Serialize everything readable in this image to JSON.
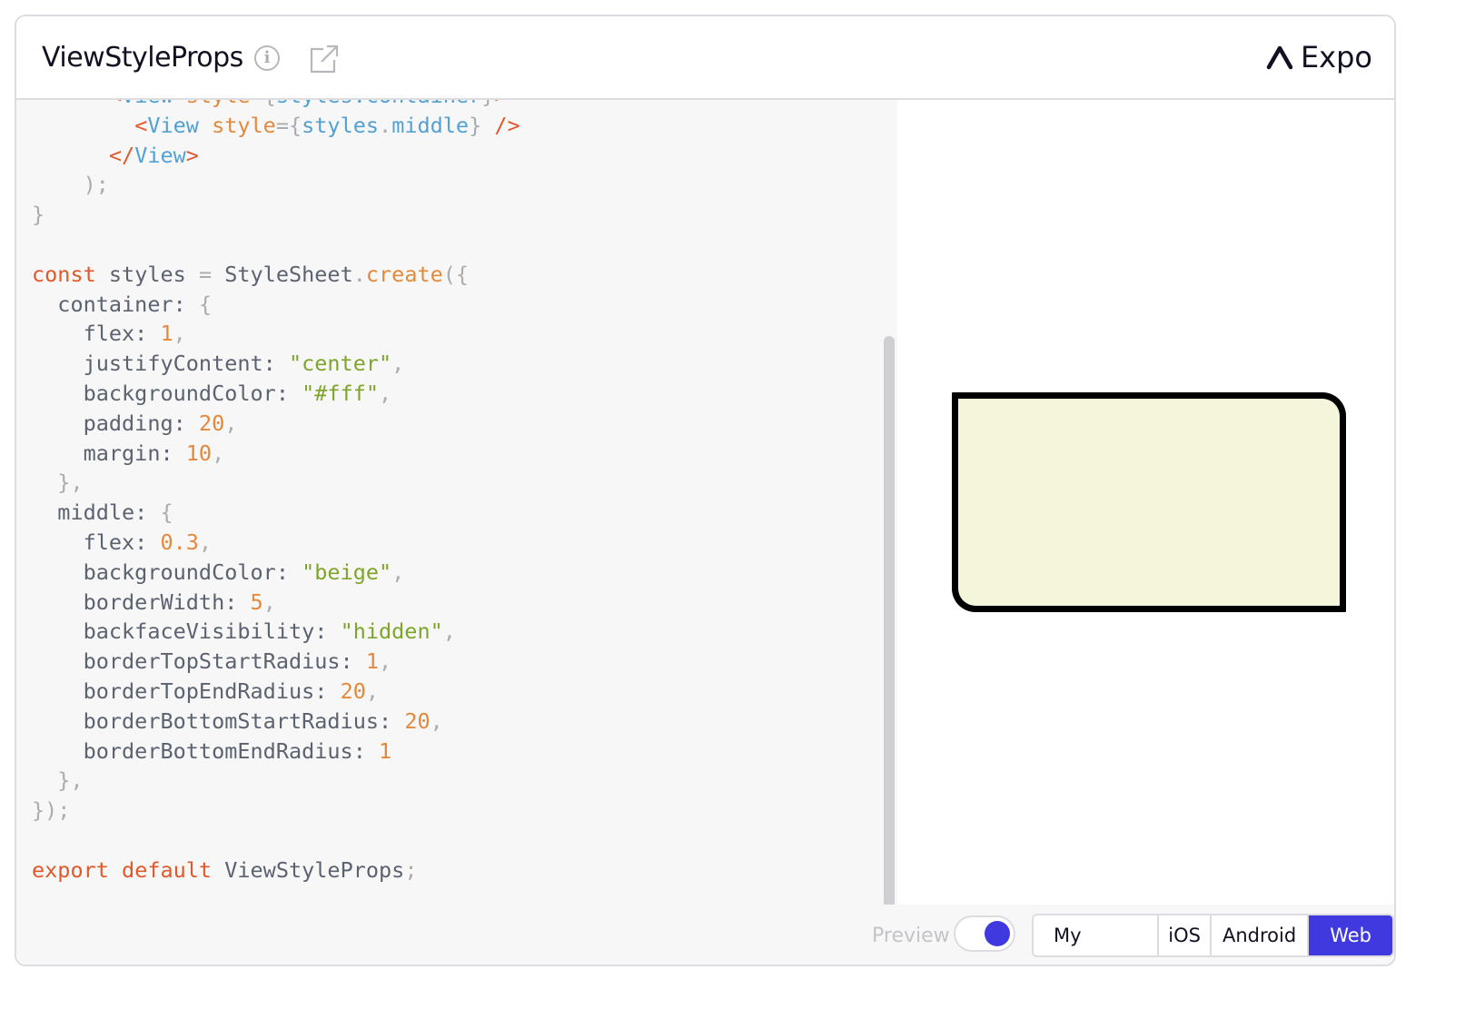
{
  "header": {
    "title": "ViewStyleProps",
    "info_icon": "info-icon",
    "open_external_icon": "external-link-icon",
    "brand": "Expo",
    "brand_icon": "expo-logo-icon"
  },
  "code": {
    "lines": [
      [
        {
          "c": "t",
          "v": "      "
        },
        {
          "c": "k",
          "v": "<"
        },
        {
          "c": "t",
          "v": "View "
        },
        {
          "c": "a",
          "v": "style"
        },
        {
          "c": "p",
          "v": "={"
        },
        {
          "c": "t",
          "v": "styles.container"
        },
        {
          "c": "p",
          "v": "}"
        },
        {
          "c": "k",
          "v": ">"
        }
      ],
      [
        {
          "c": "t",
          "v": "        "
        },
        {
          "c": "k",
          "v": "<"
        },
        {
          "c": "t",
          "v": "View "
        },
        {
          "c": "a",
          "v": "style"
        },
        {
          "c": "p",
          "v": "={"
        },
        {
          "c": "t",
          "v": "styles"
        },
        {
          "c": "p",
          "v": "."
        },
        {
          "c": "t",
          "v": "middle"
        },
        {
          "c": "p",
          "v": "}"
        },
        {
          "c": "t",
          "v": " "
        },
        {
          "c": "k",
          "v": "/>"
        }
      ],
      [
        {
          "c": "t",
          "v": "      "
        },
        {
          "c": "k",
          "v": "</"
        },
        {
          "c": "t",
          "v": "View"
        },
        {
          "c": "k",
          "v": ">"
        }
      ],
      [
        {
          "c": "p",
          "v": "    );"
        }
      ],
      [
        {
          "c": "p",
          "v": "}"
        }
      ],
      [
        {
          "c": "",
          "v": ""
        }
      ],
      [
        {
          "c": "k",
          "v": "const"
        },
        {
          "c": "",
          "v": " styles "
        },
        {
          "c": "p",
          "v": "="
        },
        {
          "c": "",
          "v": " StyleSheet"
        },
        {
          "c": "p",
          "v": "."
        },
        {
          "c": "f",
          "v": "create"
        },
        {
          "c": "p",
          "v": "({"
        }
      ],
      [
        {
          "c": "",
          "v": "  container: "
        },
        {
          "c": "p",
          "v": "{"
        }
      ],
      [
        {
          "c": "",
          "v": "    flex: "
        },
        {
          "c": "n",
          "v": "1"
        },
        {
          "c": "p",
          "v": ","
        }
      ],
      [
        {
          "c": "",
          "v": "    justifyContent: "
        },
        {
          "c": "s",
          "v": "\"center\""
        },
        {
          "c": "p",
          "v": ","
        }
      ],
      [
        {
          "c": "",
          "v": "    backgroundColor: "
        },
        {
          "c": "s",
          "v": "\"#fff\""
        },
        {
          "c": "p",
          "v": ","
        }
      ],
      [
        {
          "c": "",
          "v": "    padding: "
        },
        {
          "c": "n",
          "v": "20"
        },
        {
          "c": "p",
          "v": ","
        }
      ],
      [
        {
          "c": "",
          "v": "    margin: "
        },
        {
          "c": "n",
          "v": "10"
        },
        {
          "c": "p",
          "v": ","
        }
      ],
      [
        {
          "c": "p",
          "v": "  },"
        }
      ],
      [
        {
          "c": "",
          "v": "  middle: "
        },
        {
          "c": "p",
          "v": "{"
        }
      ],
      [
        {
          "c": "",
          "v": "    flex: "
        },
        {
          "c": "n",
          "v": "0.3"
        },
        {
          "c": "p",
          "v": ","
        }
      ],
      [
        {
          "c": "",
          "v": "    backgroundColor: "
        },
        {
          "c": "s",
          "v": "\"beige\""
        },
        {
          "c": "p",
          "v": ","
        }
      ],
      [
        {
          "c": "",
          "v": "    borderWidth: "
        },
        {
          "c": "n",
          "v": "5"
        },
        {
          "c": "p",
          "v": ","
        }
      ],
      [
        {
          "c": "",
          "v": "    backfaceVisibility: "
        },
        {
          "c": "s",
          "v": "\"hidden\""
        },
        {
          "c": "p",
          "v": ","
        }
      ],
      [
        {
          "c": "",
          "v": "    borderTopStartRadius: "
        },
        {
          "c": "n",
          "v": "1"
        },
        {
          "c": "p",
          "v": ","
        }
      ],
      [
        {
          "c": "",
          "v": "    borderTopEndRadius: "
        },
        {
          "c": "n",
          "v": "20"
        },
        {
          "c": "p",
          "v": ","
        }
      ],
      [
        {
          "c": "",
          "v": "    borderBottomStartRadius: "
        },
        {
          "c": "n",
          "v": "20"
        },
        {
          "c": "p",
          "v": ","
        }
      ],
      [
        {
          "c": "",
          "v": "    borderBottomEndRadius: "
        },
        {
          "c": "n",
          "v": "1"
        }
      ],
      [
        {
          "c": "p",
          "v": "  },"
        }
      ],
      [
        {
          "c": "p",
          "v": "});"
        }
      ],
      [
        {
          "c": "",
          "v": ""
        }
      ],
      [
        {
          "c": "k",
          "v": "export"
        },
        {
          "c": "",
          "v": " "
        },
        {
          "c": "k",
          "v": "default"
        },
        {
          "c": "",
          "v": " ViewStyleProps"
        },
        {
          "c": "p",
          "v": ";"
        }
      ]
    ]
  },
  "preview": {
    "box": {
      "background": "#f5f5dc",
      "border_color": "#000000"
    }
  },
  "footer": {
    "preview_label": "Preview",
    "preview_toggle_on": true,
    "platforms": [
      "My Device",
      "iOS",
      "Android",
      "Web"
    ],
    "selected_platform": "Web",
    "accent_color": "#4039e0"
  }
}
